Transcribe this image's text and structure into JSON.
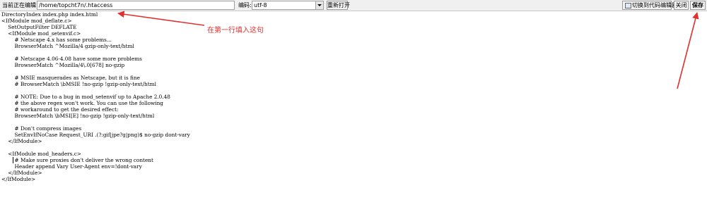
{
  "toolbar": {
    "editing_label": "当前正在编辑:",
    "file_path": "/home/topcht7n/.htaccess",
    "encoding_label": "编码:",
    "encoding_value": "utf-8",
    "reopen_label": "重新打开",
    "switch_editor_label": "切换到代码编辑器",
    "close_label": "关闭",
    "save_label": "保存"
  },
  "code_lines": [
    "DirectoryIndex index.php index.html",
    "<IfModule mod_deflate.c>",
    "    SetOutputFilter DEFLATE",
    "    <IfModule mod_setenvif.c>",
    "        # Netscape 4.x has some problems...",
    "        BrowserMatch ^Mozilla/4 gzip-only-text/html",
    "",
    "        # Netscape 4.06-4.08 have some more problems",
    "        BrowserMatch ^Mozilla/4\\.0[678] no-gzip",
    "",
    "        # MSIE masquerades as Netscape, but it is fine",
    "        # BrowserMatch \\bMSIE !no-gzip !gzip-only-text/html",
    "",
    "        # NOTE: Due to a bug in mod_setenvif up to Apache 2.0.48",
    "        # the above regex won't work. You can use the following",
    "        # workaround to get the desired effect:",
    "        BrowserMatch \\bMSI[E] !no-gzip !gzip-only-text/html",
    "",
    "        # Don't compress images",
    "        SetEnvIfNoCase Request_URI .(?:gif|jpe?g|png)$ no-gzip dont-vary",
    "    </IfModule>",
    "",
    "    <IfModule mod_headers.c>",
    "        # Make sure proxies don't deliver the wrong content",
    "        Header append Vary User-Agent env=!dont-vary",
    "    </IfModule>",
    "</IfModule>"
  ],
  "annotation": {
    "text": "在第一行填入这句",
    "color": "#e03030"
  }
}
